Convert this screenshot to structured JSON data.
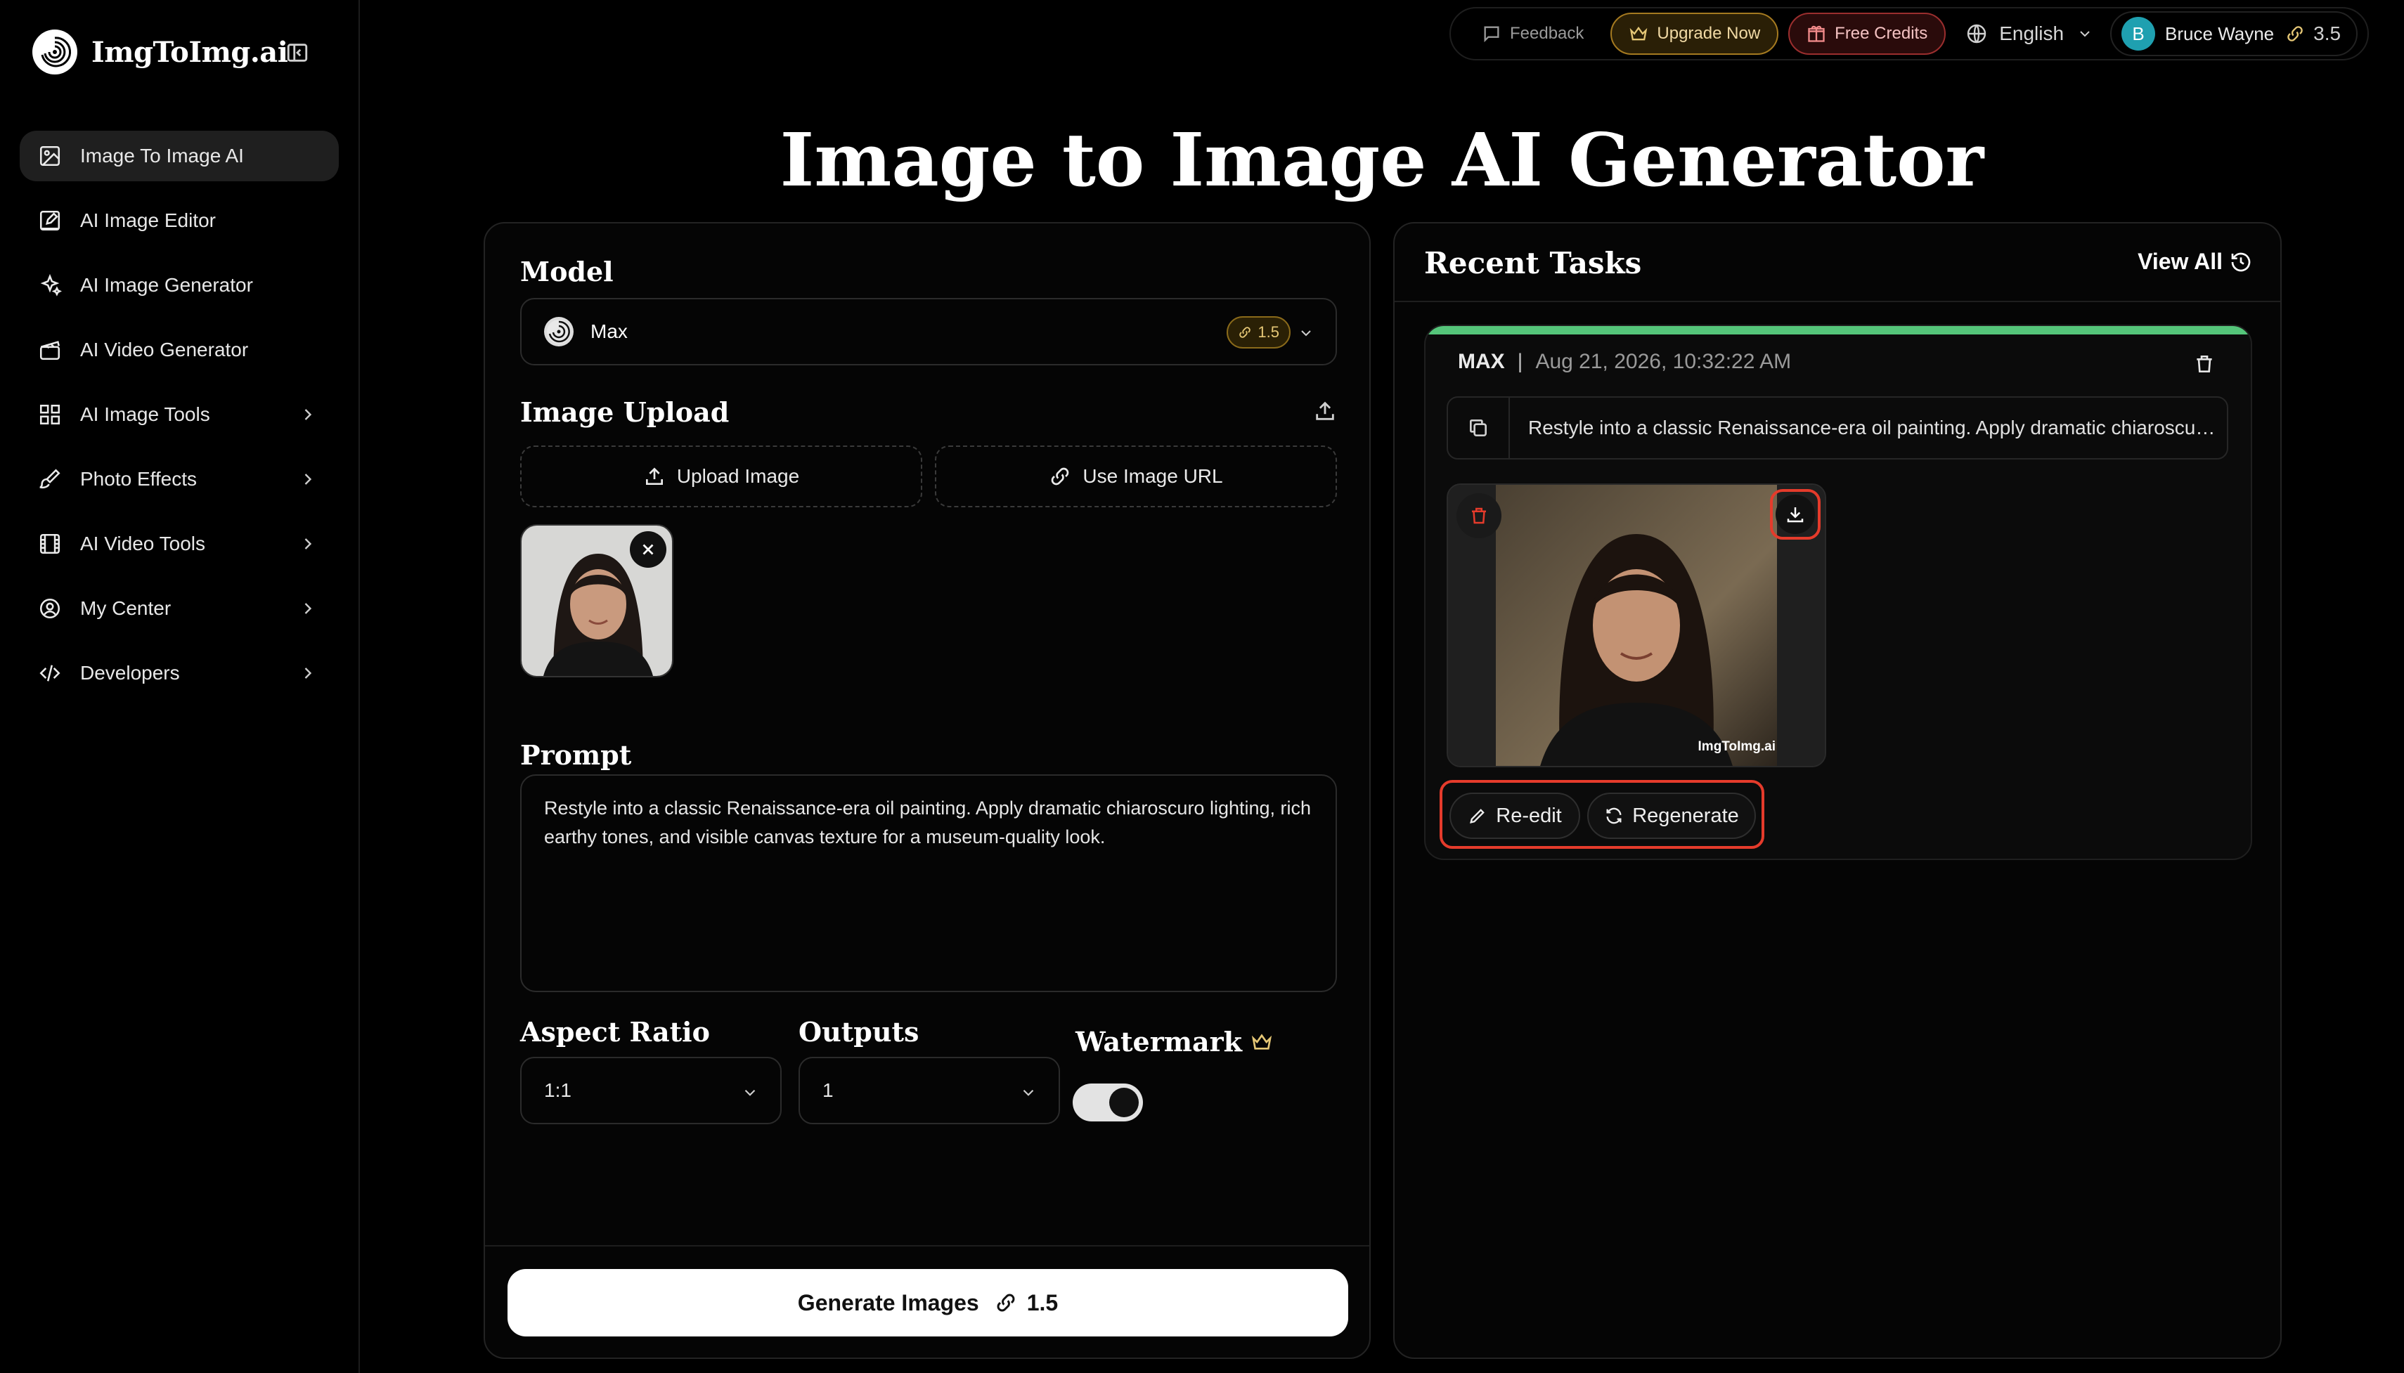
{
  "brand": {
    "name": "ImgToImg.ai"
  },
  "sidebar": {
    "items": [
      {
        "label": "Image To Image AI",
        "icon": "image-edit-icon",
        "active": true,
        "expandable": false
      },
      {
        "label": "AI Image Editor",
        "icon": "pencil-square-icon",
        "active": false,
        "expandable": false
      },
      {
        "label": "AI Image Generator",
        "icon": "sparkles-icon",
        "active": false,
        "expandable": false
      },
      {
        "label": "AI Video Generator",
        "icon": "clapperboard-icon",
        "active": false,
        "expandable": false
      },
      {
        "label": "AI Image Tools",
        "icon": "grid-icon",
        "active": false,
        "expandable": true
      },
      {
        "label": "Photo Effects",
        "icon": "brush-icon",
        "active": false,
        "expandable": true
      },
      {
        "label": "AI Video Tools",
        "icon": "film-icon",
        "active": false,
        "expandable": true
      },
      {
        "label": "My Center",
        "icon": "user-circle-icon",
        "active": false,
        "expandable": true
      },
      {
        "label": "Developers",
        "icon": "code-icon",
        "active": false,
        "expandable": true
      }
    ]
  },
  "topbar": {
    "feedback": "Feedback",
    "upgrade": "Upgrade Now",
    "credits": "Free Credits",
    "language": "English",
    "user": {
      "initial": "B",
      "name": "Bruce Wayne",
      "credits": "3.5"
    }
  },
  "page": {
    "title": "Image to Image AI Generator"
  },
  "form": {
    "model_label": "Model",
    "model_name": "Max",
    "model_cost": "1.5",
    "upload_label": "Image Upload",
    "upload_button": "Upload Image",
    "url_button": "Use Image URL",
    "prompt_label": "Prompt",
    "prompt_value": "Restyle into a classic Renaissance-era oil painting. Apply dramatic chiaroscuro lighting, rich earthy tones, and visible canvas texture for a museum-quality look.",
    "aspect_label": "Aspect Ratio",
    "aspect_value": "1:1",
    "outputs_label": "Outputs",
    "outputs_value": "1",
    "watermark_label": "Watermark",
    "watermark_on": true,
    "generate_label": "Generate Images",
    "generate_cost": "1.5"
  },
  "recent": {
    "title": "Recent Tasks",
    "view_all": "View All",
    "task": {
      "model": "MAX",
      "separator": "|",
      "date": "Aug 21, 2026, 10:32:22 AM",
      "prompt": "Restyle into a classic Renaissance-era oil painting. Apply dramatic chiaroscuro lighting, rich earthy tones, and visible canvas texture for a museum-quality look.",
      "watermark": "ImgToImg.ai",
      "reedit": "Re-edit",
      "regenerate": "Regenerate",
      "progress": 1.0
    }
  },
  "colors": {
    "accent_gold": "#e5c776",
    "accent_red": "#e53b2b",
    "progress_green": "#55c57a",
    "avatar_teal": "#1fa0b0"
  }
}
